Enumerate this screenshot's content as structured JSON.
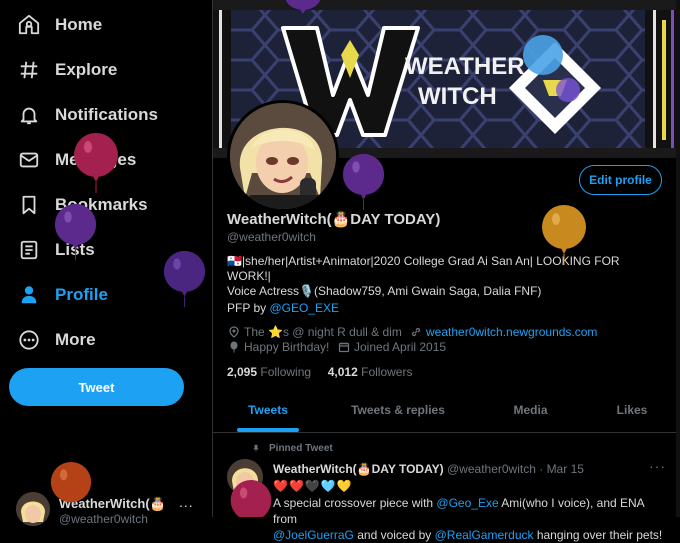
{
  "nav": {
    "items": [
      {
        "label": "Home",
        "icon": "home-icon"
      },
      {
        "label": "Explore",
        "icon": "hashtag-icon"
      },
      {
        "label": "Notifications",
        "icon": "bell-icon"
      },
      {
        "label": "Messages",
        "icon": "envelope-icon"
      },
      {
        "label": "Bookmarks",
        "icon": "bookmark-icon"
      },
      {
        "label": "Lists",
        "icon": "list-icon"
      },
      {
        "label": "Profile",
        "icon": "person-icon"
      },
      {
        "label": "More",
        "icon": "more-circle-icon"
      }
    ],
    "active": "Profile",
    "tweet_button": "Tweet"
  },
  "account": {
    "name": "WeatherWitch(🎂",
    "handle": "@weather0witch",
    "more": "..."
  },
  "banner": {
    "logo_text_1": "WEATHER",
    "logo_text_2": "WITCH"
  },
  "profile": {
    "edit_button": "Edit profile",
    "display_name": "WeatherWitch(🎂DAY TODAY)",
    "handle": "@weather0witch",
    "bio_line1": "🇵🇦|she/her|Artist+Animator|2020 College Grad Ai San An| LOOKING FOR WORK!|",
    "bio_line2": "Voice Actress🎙️(Shadow759, Ami Gwain Saga, Dalia FNF)",
    "pfp_prefix": "PFP by ",
    "pfp_link": "@GEO_EXE",
    "location": "The ⭐s @ night R dull & dim",
    "website": "weather0witch.newgrounds.com",
    "birthday": "Happy Birthday!",
    "joined": "Joined April 2015",
    "following_count": "2,095",
    "following_label": "Following",
    "followers_count": "4,012",
    "followers_label": "Followers"
  },
  "tabs": [
    {
      "label": "Tweets"
    },
    {
      "label": "Tweets & replies"
    },
    {
      "label": "Media"
    },
    {
      "label": "Likes"
    }
  ],
  "pinned_tweet": {
    "pinned_label": "Pinned Tweet",
    "name": "WeatherWitch(🎂DAY TODAY)",
    "handle": "@weather0witch",
    "date": "· Mar 15",
    "hearts": "❤️❤️🖤🩵💛",
    "text_1": "A special crossover piece with ",
    "mention_1": "@Geo_Exe",
    "text_2": " Ami(who I voice), and ENA from",
    "mention_2": "@JoelGuerraG",
    "text_3": " and voiced by ",
    "mention_3": "@RealGamerduck",
    "text_4": " hanging over their pets!"
  },
  "colors": {
    "accent": "#1da1f2",
    "background": "#000000",
    "muted": "#6e767d"
  }
}
